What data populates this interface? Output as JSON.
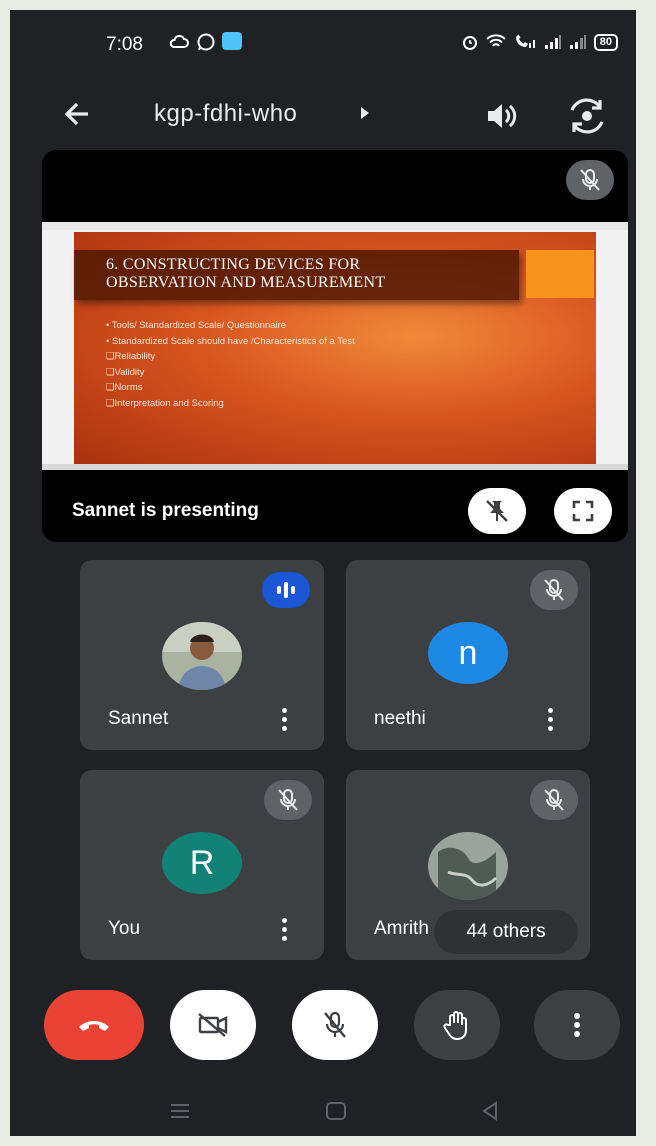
{
  "status_bar": {
    "time": "7:08",
    "battery": "80",
    "left_icons": [
      "cloud-sync-icon",
      "whatsapp-icon",
      "message-icon"
    ],
    "right_icons": [
      "alarm-icon",
      "wifi-icon",
      "volte-call-icon",
      "signal-icon",
      "signal-icon",
      "battery-icon"
    ]
  },
  "header": {
    "meeting_code": "kgp-fdhi-who",
    "icons": [
      "back-arrow-icon",
      "meeting-info-chevron-icon",
      "speaker-icon",
      "switch-camera-icon"
    ]
  },
  "presentation": {
    "presenter_label": "Sannet is presenting",
    "slide": {
      "title_line1": "6. CONSTRUCTING DEVICES FOR",
      "title_line2": "OBSERVATION AND MEASUREMENT",
      "bullets": [
        "• Tools/ Standardized Scale/ Questionnaire",
        "• Standardized Scale should have /Characteristics of a Test",
        "❑Reliability",
        "❑Validity",
        "❑Norms",
        "❑Interpretation and Scoring"
      ]
    },
    "buttons": [
      "unpin-icon",
      "fullscreen-icon"
    ],
    "colors": {
      "slide_orange": "#d8541f",
      "accent": "#f7941d"
    }
  },
  "participants": [
    {
      "name": "Sannet",
      "status": "speaking",
      "avatar": "photo"
    },
    {
      "name": "neethi",
      "status": "muted",
      "avatar_letter": "n",
      "avatar_color": "#1e88e5"
    },
    {
      "name": "You",
      "status": "muted",
      "avatar_letter": "R",
      "avatar_color": "#128277"
    },
    {
      "name": "Amrith",
      "status": "muted",
      "avatar": "photo"
    }
  ],
  "others_label": "44 others",
  "controls": {
    "end_call_color": "#ea4335",
    "buttons": [
      "end-call-icon",
      "camera-off-icon",
      "mic-off-icon",
      "raise-hand-icon",
      "more-options-icon"
    ]
  },
  "nav": [
    "menu-icon",
    "home-icon",
    "back-icon"
  ]
}
